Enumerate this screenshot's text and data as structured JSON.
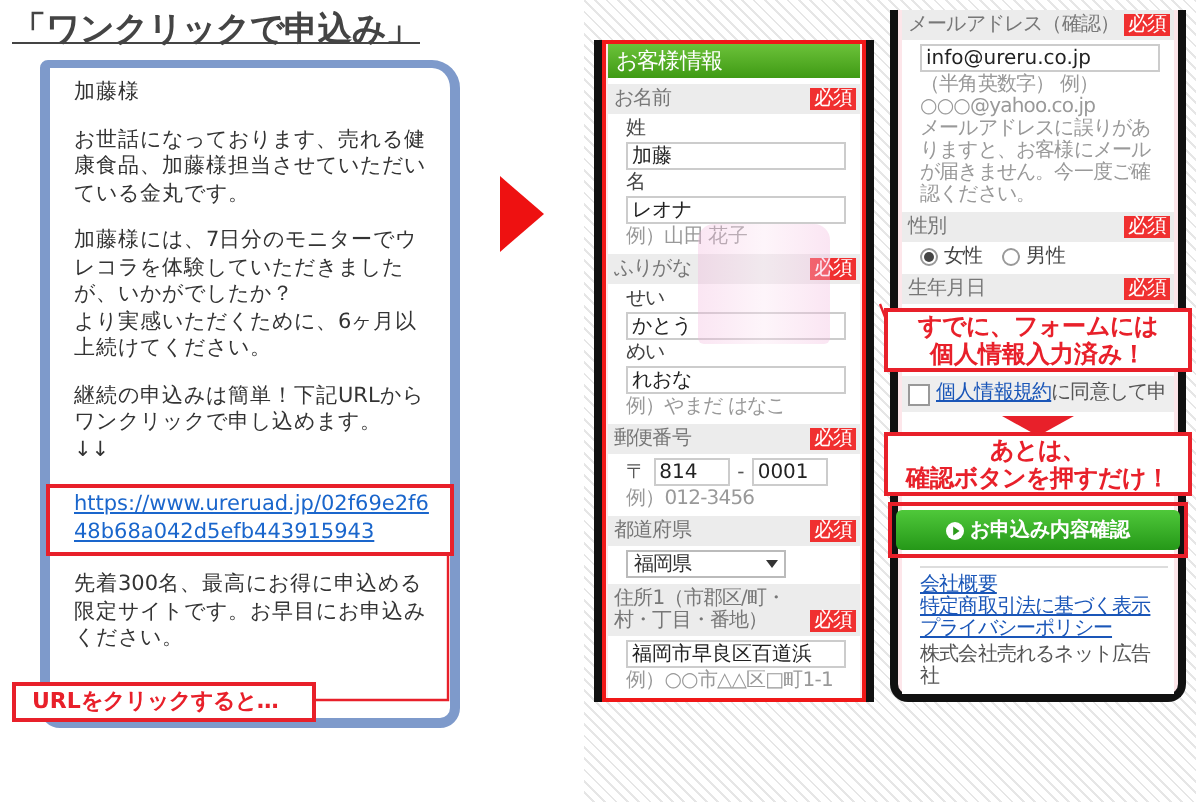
{
  "title": "「ワンクリックで申込み」",
  "message": {
    "paragraphs": [
      [
        "加藤様"
      ],
      [
        "お世話になっております、売れる健康食品、加藤様担当させていただいている金丸です。"
      ],
      [
        "加藤様には、7日分のモニターでウレコラを体験していただきましたが、いかがでしたか？",
        "より実感いただくために、6ヶ月以上続けてください。"
      ],
      [
        "継続の申込みは簡単！下記URLからワンクリックで申し込めます。",
        "↓↓"
      ]
    ],
    "link": "https://www.ureruad.jp/02f69e2f648b68a042d5efb443915943",
    "closing": "先着300名、最高にお得に申込める限定サイトです。お早目にお申込みください。"
  },
  "callouts": [
    {
      "lines": [
        "URLをクリックすると…"
      ]
    }
  ],
  "phones": [
    {
      "highlighted": true,
      "photo": true,
      "header": "お客様情報",
      "sections": [
        {
          "kind": "fields",
          "label": "お名前",
          "badge": "必須",
          "fields": [
            {
              "label": "姓",
              "value": "加藤"
            },
            {
              "label": "名",
              "value": "レオナ"
            }
          ],
          "hint": [
            "例）山田 花子"
          ]
        },
        {
          "kind": "fields",
          "label": "ふりがな",
          "badge": "必須",
          "fields": [
            {
              "label": "せい",
              "value": "かとう"
            },
            {
              "label": "めい",
              "value": "れおな"
            }
          ],
          "hint": [
            "例）やまだ はなこ"
          ]
        },
        {
          "kind": "zip",
          "label": "郵便番号",
          "badge": "必須",
          "prefix": "〒",
          "values": [
            "814",
            "0001"
          ],
          "separator": "-",
          "hint": [
            "例）012-3456"
          ]
        },
        {
          "kind": "select",
          "label": "都道府県",
          "badge": "必須",
          "value": "福岡県"
        },
        {
          "kind": "fields",
          "label": "住所1（市郡区/町・村・丁目・番地）",
          "badge": "必須",
          "fields": [
            {
              "value": "福岡市早良区百道浜"
            }
          ],
          "hint": [
            "例）○○市△△区□町1-1"
          ]
        }
      ]
    },
    {
      "highlighted": false,
      "photo": false,
      "sections": [
        {
          "kind": "fields",
          "label": "メールアドレス（確認）",
          "badge": "必須",
          "fields": [
            {
              "value": "info@ureru.co.jp"
            }
          ],
          "hint": [
            "（半角英数字） 例）",
            "○○○@yahoo.co.jp",
            "メールアドレスに誤りがありますと、お客様にメールが届きません。今一度ご確認ください。"
          ]
        },
        {
          "kind": "radio",
          "label": "性別",
          "badge": "必須",
          "options": [
            {
              "label": "女性",
              "selected": true
            },
            {
              "label": "男性",
              "selected": false
            }
          ]
        },
        {
          "kind": "header",
          "label": "生年月日",
          "badge": "必須"
        },
        {
          "kind": "callout",
          "pointer": false,
          "lines": [
            "すでに、フォームには",
            "個人情報入力済み！"
          ]
        },
        {
          "kind": "consent",
          "checked": false,
          "link": "個人情報規約",
          "text": "に同意して申"
        },
        {
          "kind": "callout",
          "pointer": true,
          "lines": [
            "あとは、",
            "確認ボタンを押すだけ！"
          ]
        },
        {
          "kind": "button",
          "label": "お申込み内容確認",
          "highlighted": true
        },
        {
          "kind": "links",
          "links": [
            "会社概要",
            "特定商取引法に基づく表示",
            "プライバシーポリシー"
          ]
        },
        {
          "kind": "text",
          "text": "株式会社売れるネット広告社"
        }
      ]
    }
  ]
}
